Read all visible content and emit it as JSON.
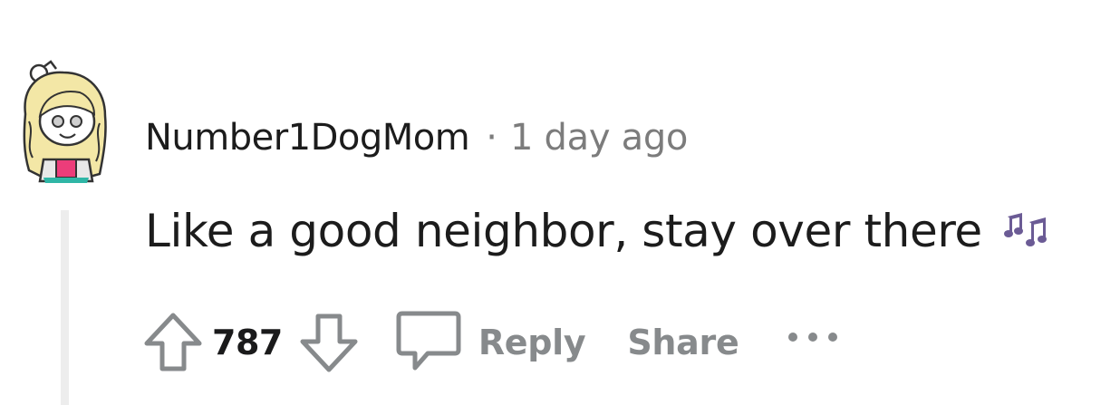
{
  "comment": {
    "author": "Number1DogMom",
    "separator": "·",
    "timestamp": "1 day ago",
    "body": "Like a good neighbor, stay over there",
    "score": "787"
  },
  "actions": {
    "reply_label": "Reply",
    "share_label": "Share"
  },
  "icons": {
    "avatar": "snoo-avatar-icon",
    "emoji": "music-notes-icon",
    "upvote": "upvote-arrow-icon",
    "downvote": "downvote-arrow-icon",
    "reply": "comment-bubble-icon",
    "more": "more-options-icon"
  },
  "colors": {
    "meta_gray": "#7c7c7c",
    "action_gray": "#878a8c",
    "thread_line": "#ededed",
    "emoji_purple": "#6b5b95"
  }
}
